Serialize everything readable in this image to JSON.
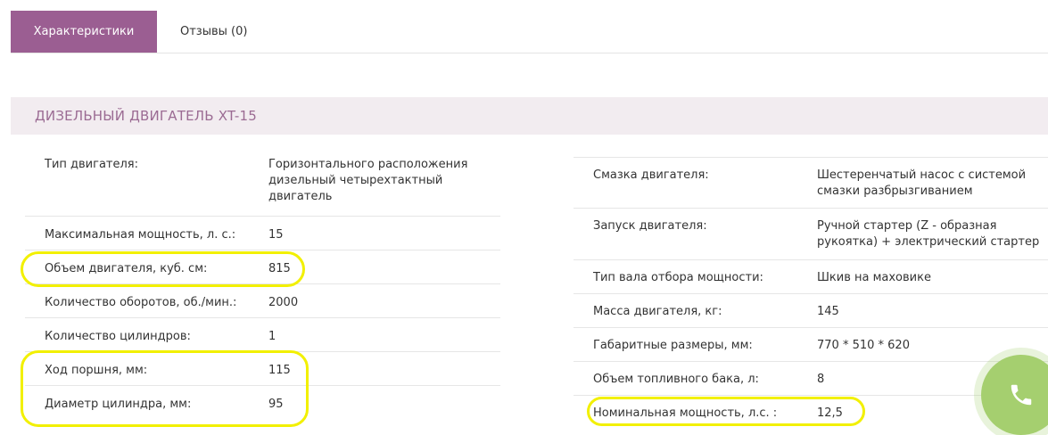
{
  "tabs": [
    {
      "label": "Характеристики",
      "active": true
    },
    {
      "label": "Отзывы (0)",
      "active": false
    }
  ],
  "section_title": "ДИЗЕЛЬНЫЙ ДВИГАТЕЛЬ XT-15",
  "left_specs": [
    {
      "label": "Тип двигателя:",
      "value": "Горизонтального расположения дизельный четырехтактный двигатель"
    },
    {
      "label": "Максимальная мощность, л. с.:",
      "value": "15"
    },
    {
      "label": "Объем двигателя, куб. см:",
      "value": "815"
    },
    {
      "label": "Количество оборотов, об./мин.:",
      "value": "2000"
    },
    {
      "label": "Количество цилиндров:",
      "value": "1"
    },
    {
      "label": "Ход поршня, мм:",
      "value": "115"
    },
    {
      "label": "Диаметр цилиндра, мм:",
      "value": "95"
    }
  ],
  "right_specs": [
    {
      "label": "Смазка двигателя:",
      "value": "Шестеренчатый насос с системой смазки разбрызгиванием"
    },
    {
      "label": "Запуск двигателя:",
      "value": "Ручной стартер (Z - образная рукоятка) + электрический стартер"
    },
    {
      "label": "Тип вала отбора мощности:",
      "value": "Шкив на маховике"
    },
    {
      "label": "Масса двигателя, кг:",
      "value": "145"
    },
    {
      "label": "Габаритные размеры, мм:",
      "value": "770 * 510 * 620"
    },
    {
      "label": "Объем топливного бака, л:",
      "value": "8"
    },
    {
      "label": "Номинальная мощность, л.с. :",
      "value": "12,5"
    }
  ],
  "colors": {
    "tab_active": "#9b5e92",
    "section_bg": "#f2ecf0",
    "section_text": "#9b6b93",
    "highlight": "#f2f000",
    "call_button": "#a5cf6f"
  },
  "icons": {
    "call": "phone-icon"
  }
}
